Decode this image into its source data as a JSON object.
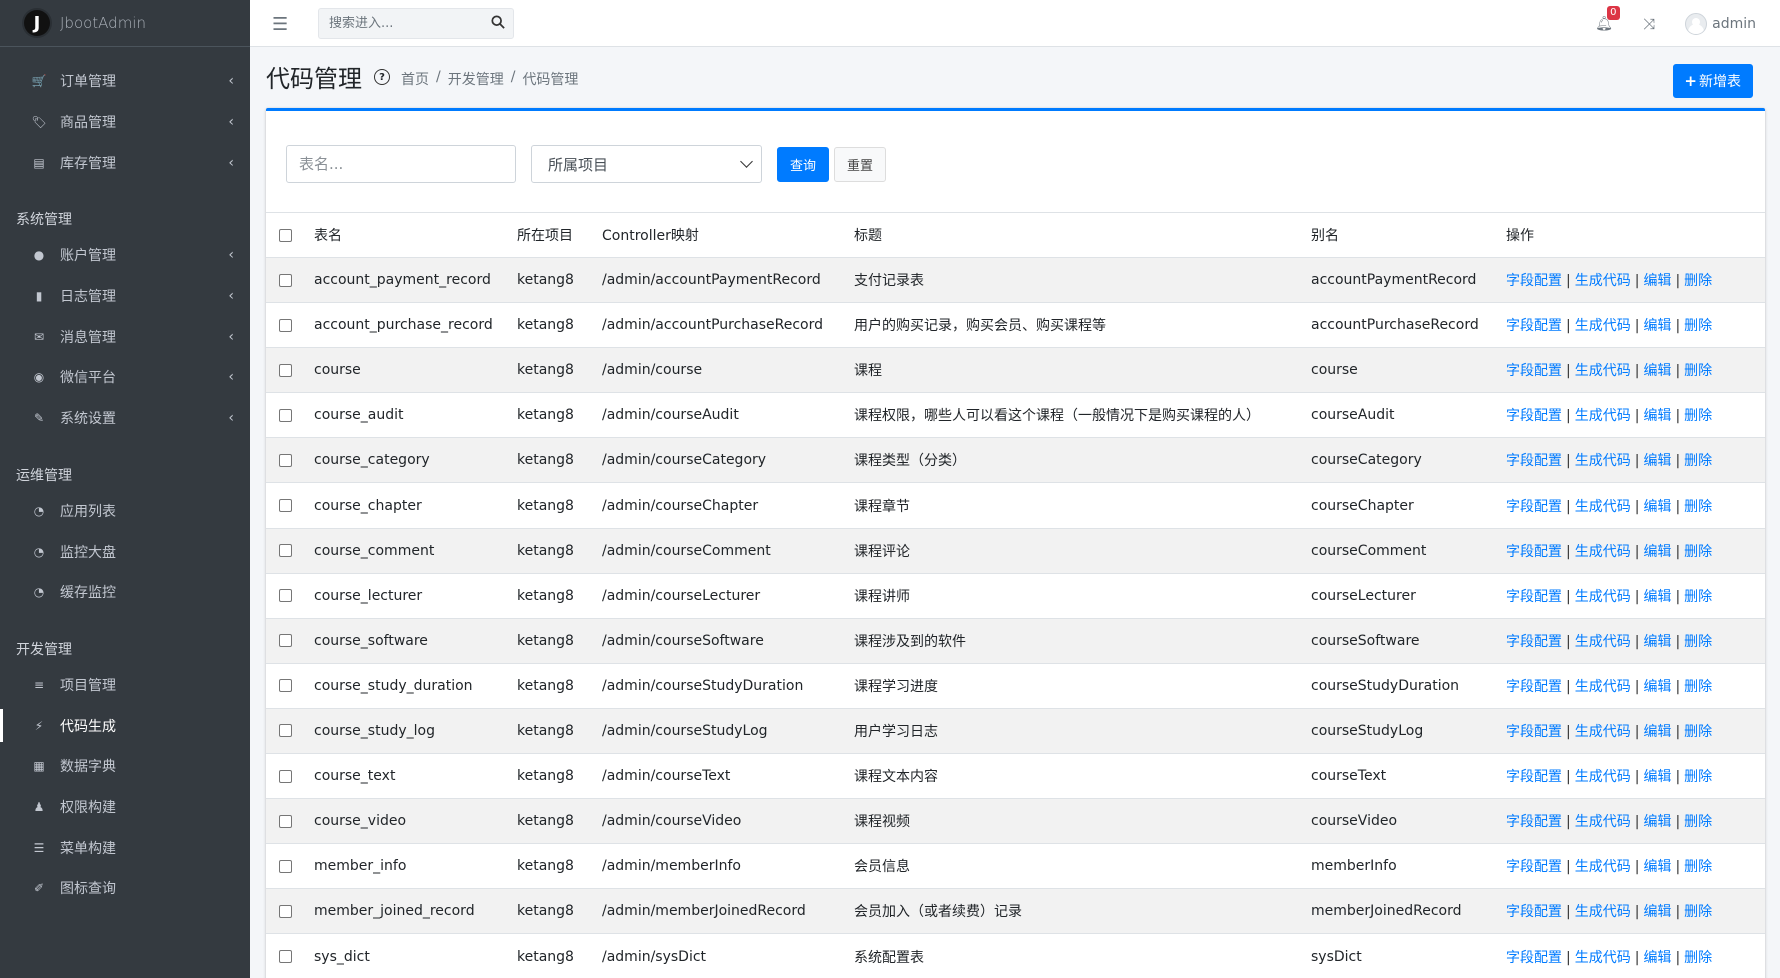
{
  "brand": {
    "logo": "J",
    "name": "JbootAdmin"
  },
  "sidebar": {
    "group1": [
      {
        "icon": "cart-icon",
        "glyph": "🛒",
        "label": "订单管理",
        "chevron": true
      },
      {
        "icon": "tag-icon",
        "glyph": "🏷",
        "label": "商品管理",
        "chevron": true
      },
      {
        "icon": "warehouse-icon",
        "glyph": "▤",
        "label": "库存管理",
        "chevron": true
      }
    ],
    "header_system": "系统管理",
    "group2": [
      {
        "icon": "user-icon",
        "glyph": "●",
        "label": "账户管理",
        "chevron": true
      },
      {
        "icon": "log-icon",
        "glyph": "▮",
        "label": "日志管理",
        "chevron": true
      },
      {
        "icon": "message-icon",
        "glyph": "✉",
        "label": "消息管理",
        "chevron": true
      },
      {
        "icon": "wechat-icon",
        "glyph": "◉",
        "label": "微信平台",
        "chevron": true
      },
      {
        "icon": "wrench-icon",
        "glyph": "✎",
        "label": "系统设置",
        "chevron": true
      }
    ],
    "header_ops": "运维管理",
    "group3": [
      {
        "icon": "dashboard-icon",
        "glyph": "◔",
        "label": "应用列表"
      },
      {
        "icon": "dashboard-icon",
        "glyph": "◔",
        "label": "监控大盘"
      },
      {
        "icon": "dashboard-icon",
        "glyph": "◔",
        "label": "缓存监控"
      }
    ],
    "header_dev": "开发管理",
    "group4": [
      {
        "icon": "database-icon",
        "glyph": "≡",
        "label": "项目管理"
      },
      {
        "icon": "bolt-icon",
        "glyph": "⚡",
        "label": "代码生成",
        "active": true
      },
      {
        "icon": "grid-icon",
        "glyph": "▦",
        "label": "数据字典"
      },
      {
        "icon": "sitemap-icon",
        "glyph": "♟",
        "label": "权限构建"
      },
      {
        "icon": "list-icon",
        "glyph": "☰",
        "label": "菜单构建"
      },
      {
        "icon": "brush-icon",
        "glyph": "✐",
        "label": "图标查询"
      }
    ]
  },
  "topbar": {
    "search_placeholder": "搜索进入...",
    "notifications": "0",
    "user": "admin"
  },
  "header": {
    "title": "代码管理",
    "breadcrumb": [
      "首页",
      "开发管理",
      "代码管理"
    ],
    "add_button": "新增表"
  },
  "filter": {
    "name_placeholder": "表名...",
    "project_select": "所属项目",
    "query_button": "查询",
    "reset_button": "重置"
  },
  "table": {
    "columns": [
      "表名",
      "所在项目",
      "Controller映射",
      "标题",
      "别名",
      "操作"
    ],
    "actions": [
      "字段配置",
      "生成代码",
      "编辑",
      "删除"
    ],
    "rows": [
      [
        "account_payment_record",
        "ketang8",
        "/admin/accountPaymentRecord",
        "支付记录表",
        "accountPaymentRecord"
      ],
      [
        "account_purchase_record",
        "ketang8",
        "/admin/accountPurchaseRecord",
        "用户的购买记录，购买会员、购买课程等",
        "accountPurchaseRecord"
      ],
      [
        "course",
        "ketang8",
        "/admin/course",
        "课程",
        "course"
      ],
      [
        "course_audit",
        "ketang8",
        "/admin/courseAudit",
        "课程权限，哪些人可以看这个课程（一般情况下是购买课程的人）",
        "courseAudit"
      ],
      [
        "course_category",
        "ketang8",
        "/admin/courseCategory",
        "课程类型（分类）",
        "courseCategory"
      ],
      [
        "course_chapter",
        "ketang8",
        "/admin/courseChapter",
        "课程章节",
        "courseChapter"
      ],
      [
        "course_comment",
        "ketang8",
        "/admin/courseComment",
        "课程评论",
        "courseComment"
      ],
      [
        "course_lecturer",
        "ketang8",
        "/admin/courseLecturer",
        "课程讲师",
        "courseLecturer"
      ],
      [
        "course_software",
        "ketang8",
        "/admin/courseSoftware",
        "课程涉及到的软件",
        "courseSoftware"
      ],
      [
        "course_study_duration",
        "ketang8",
        "/admin/courseStudyDuration",
        "课程学习进度",
        "courseStudyDuration"
      ],
      [
        "course_study_log",
        "ketang8",
        "/admin/courseStudyLog",
        "用户学习日志",
        "courseStudyLog"
      ],
      [
        "course_text",
        "ketang8",
        "/admin/courseText",
        "课程文本内容",
        "courseText"
      ],
      [
        "course_video",
        "ketang8",
        "/admin/courseVideo",
        "课程视频",
        "courseVideo"
      ],
      [
        "member_info",
        "ketang8",
        "/admin/memberInfo",
        "会员信息",
        "memberInfo"
      ],
      [
        "member_joined_record",
        "ketang8",
        "/admin/memberJoinedRecord",
        "会员加入（或者续费）记录",
        "memberJoinedRecord"
      ],
      [
        "sys_dict",
        "ketang8",
        "/admin/sysDict",
        "系统配置表",
        "sysDict"
      ]
    ]
  },
  "colors": {
    "primary": "#007bff",
    "sidebar": "#343a40",
    "badge": "#dc3545"
  }
}
